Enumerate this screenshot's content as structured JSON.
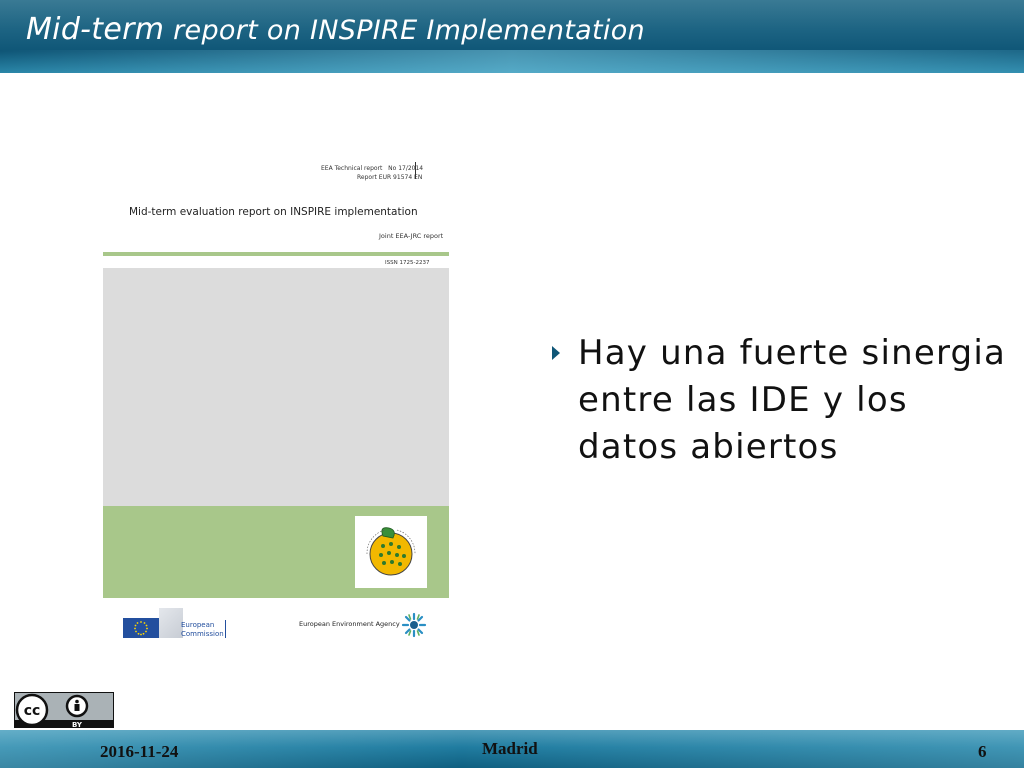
{
  "header": {
    "title_main": "Mid-term",
    "title_sub": " report on INSPIRE Implementation"
  },
  "cover": {
    "tech_line1": "EEA Technical report",
    "tech_line2": "No 17/2014",
    "tech_line3": "Report EUR 91574 EN",
    "report_title": "Mid-term evaluation report on INSPIRE implementation",
    "joint": "Joint EEA-JRC report",
    "issn": "ISSN 1725-2237",
    "ec_line1": "European",
    "ec_line2": "Commission",
    "eea": "European Environment Agency",
    "colors": {
      "green": "#a8c78a",
      "gray": "#dcdcdc",
      "eu_blue": "#234f9e"
    }
  },
  "body": {
    "bullet": "Hay una fuerte sinergia entre las IDE y los datos abiertos"
  },
  "badge": {
    "cc": "cc",
    "by": "BY"
  },
  "footer": {
    "date": "2016-11-24",
    "place": "Madrid",
    "page": "6"
  },
  "colors": {
    "accent": "#0f5677"
  }
}
